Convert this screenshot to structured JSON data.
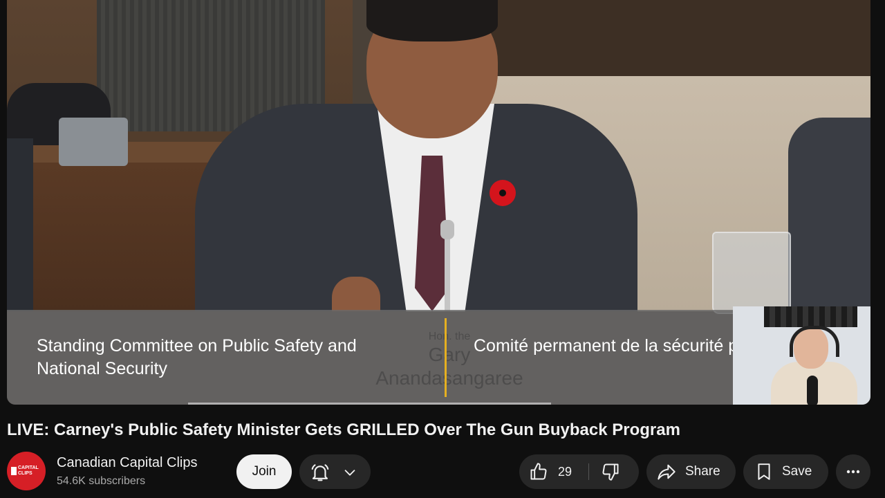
{
  "video": {
    "caption_en": "Standing Committee on Public Safety and National Security",
    "caption_fr": "Comité permanent de la sécurité publique et nationale",
    "nameplate_small": "Hon. the",
    "nameplate_first": "Gary",
    "nameplate_last": "Anandasangaree",
    "title": "LIVE: Carney's Public Safety Minister Gets GRILLED Over The Gun Buyback Program"
  },
  "channel": {
    "name": "Canadian Capital Clips",
    "subscribers": "54.6K subscribers",
    "avatar_text": "CAPITAL CLIPS",
    "join_label": "Join"
  },
  "actions": {
    "like_count": "29",
    "share_label": "Share",
    "save_label": "Save"
  },
  "icons": {
    "bell": "bell-icon",
    "chevron": "chevron-down-icon",
    "like": "thumb-up-icon",
    "dislike": "thumb-down-icon",
    "share": "share-icon",
    "save": "bookmark-icon",
    "more": "more-horizontal-icon"
  },
  "colors": {
    "background": "#0f0f0f",
    "button": "#272727",
    "join_button": "#f1f1f1",
    "caption_divider": "#e6b021",
    "avatar": "#d61f26"
  }
}
